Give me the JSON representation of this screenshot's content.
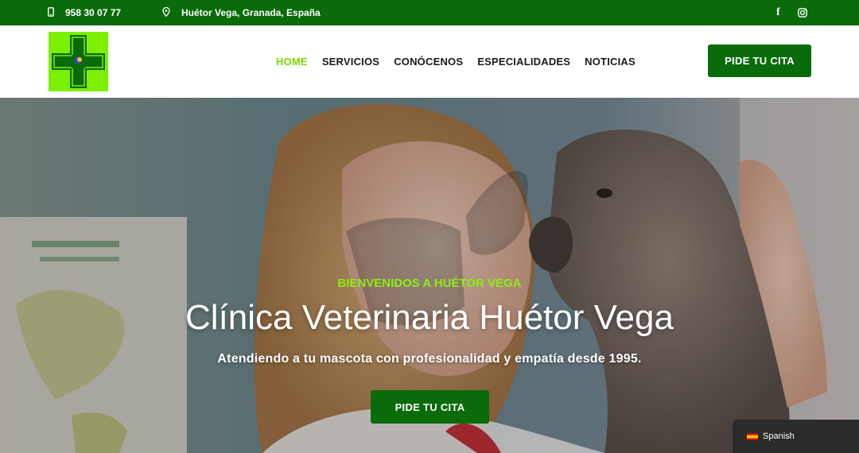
{
  "topbar": {
    "phone": "958 30 07 77",
    "location": "Huétor Vega, Granada, España",
    "social": [
      "facebook-icon",
      "instagram-icon"
    ]
  },
  "header": {
    "nav": [
      {
        "label": "HOME",
        "active": true
      },
      {
        "label": "SERVICIOS",
        "active": false
      },
      {
        "label": "CONÓCENOS",
        "active": false
      },
      {
        "label": "ESPECIALIDADES",
        "active": false
      },
      {
        "label": "NOTICIAS",
        "active": false
      }
    ],
    "cta": "PIDE TU CITA"
  },
  "hero": {
    "kicker": "BIENVENIDOS A HUÉTOR VEGA",
    "title": "Clínica Veterinaria Huétor Vega",
    "subtitle": "Atendiendo a tu mascota con profesionalidad y empatía desde 1995.",
    "cta": "PIDE TU CITA"
  },
  "language": {
    "label": "Spanish"
  },
  "colors": {
    "brand_green": "#0a6b0a",
    "accent_lime": "#7cd600"
  }
}
